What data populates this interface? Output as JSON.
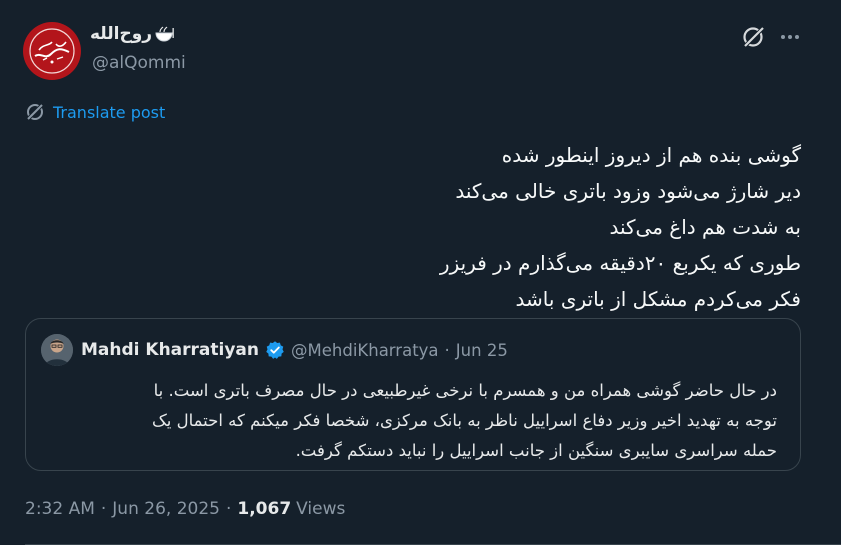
{
  "author": {
    "display_name": "روح‌الله",
    "handle": "@alQommi"
  },
  "translate_label": "Translate post",
  "tweet_lines": [
    "گوشی بنده هم از دیروز اینطور شده",
    "دیر شارژ می‌شود وزود باتری خالی می‌کند",
    "به شدت هم داغ می‌کند",
    "طوری که یکربع ۲۰دقیقه می‌گذارم در فریزر",
    "فکر می‌کردم مشکل از باتری باشد"
  ],
  "quoted": {
    "name": "Mahdi Kharratiyan",
    "handle": "@MehdiKharratya",
    "date": "Jun 25",
    "lines": [
      "در حال حاضر گوشی همراه من و همسرم با نرخی غیرطبیعی در حال مصرف باتری است. با",
      "توجه به تهدید اخیر وزیر دفاع اسراییل ناظر به بانک مرکزی، شخصا فکر میکنم که احتمال یک",
      "حمله سراسری سایبری سنگین از جانب اسراییل را نباید دستکم گرفت."
    ]
  },
  "meta": {
    "time": "2:32 AM",
    "date": "Jun 26, 2025",
    "views_count": "1,067",
    "views_label": "Views",
    "separator": "·"
  },
  "colors": {
    "background": "#15202b",
    "accent": "#1d9bf0",
    "secondary_text": "#8b98a5",
    "border": "#38444d",
    "avatar_red": "#b3151b"
  },
  "icons": {
    "grok": "grok-icon",
    "more": "more-icon",
    "translate": "translate-icon",
    "verified": "verified-badge-icon",
    "bowl": "bowl-emoji-icon"
  }
}
